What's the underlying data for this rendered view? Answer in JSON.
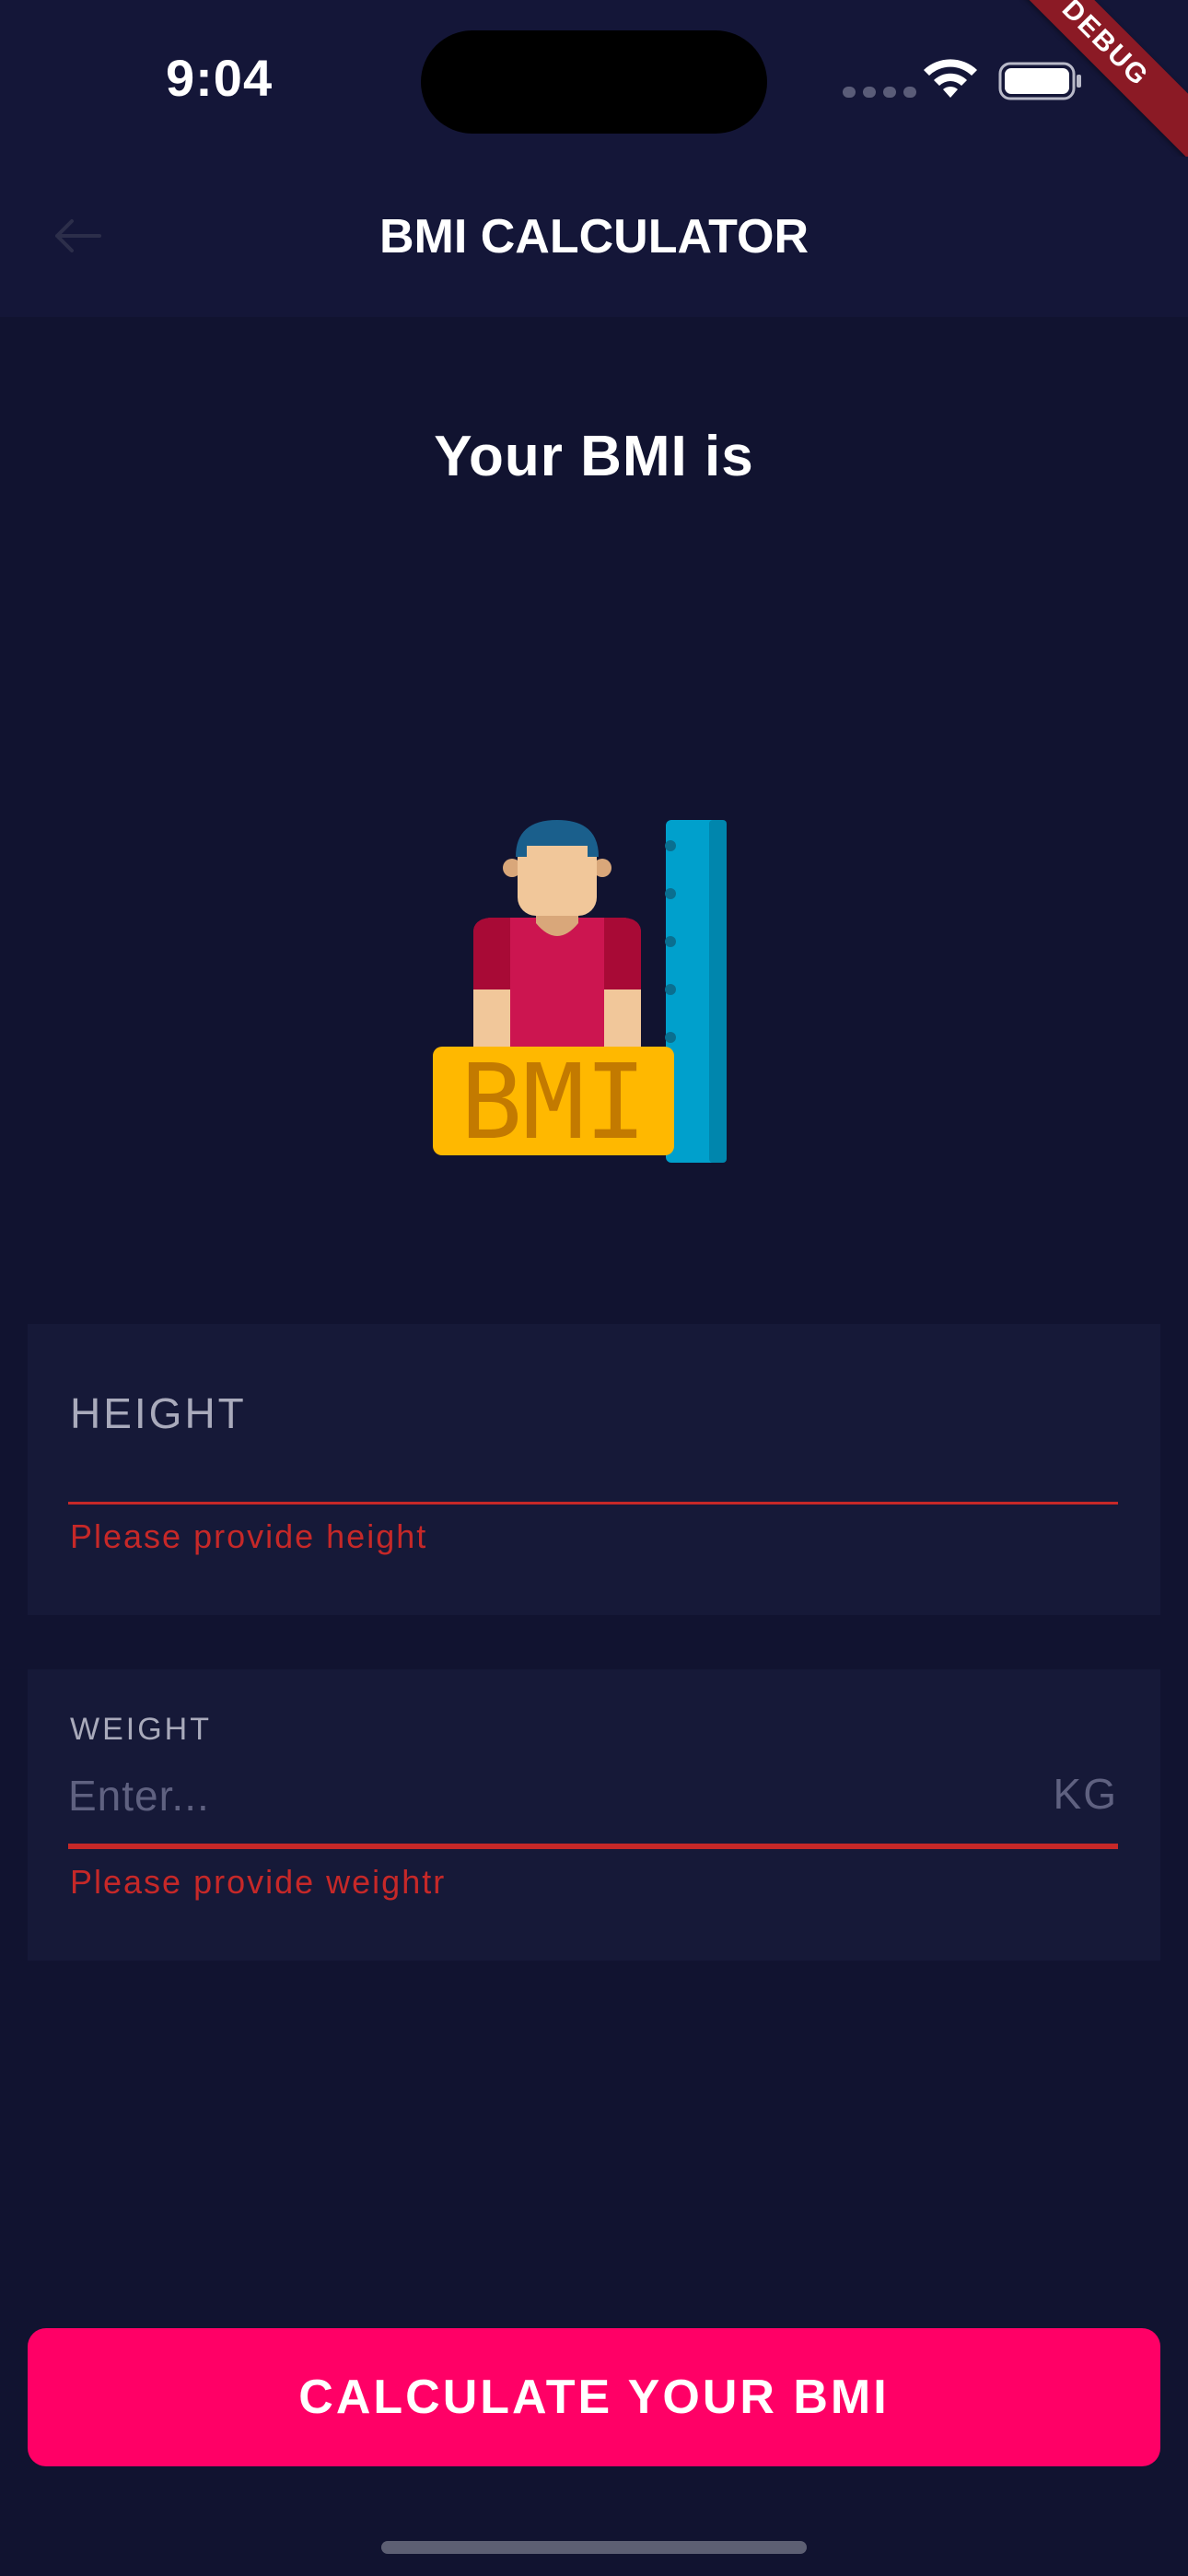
{
  "status_bar": {
    "time": "9:04",
    "debug_ribbon": "DEBUG"
  },
  "app_bar": {
    "title": "BMI CALCULATOR",
    "back_icon": "arrow-left-icon"
  },
  "result": {
    "heading": "Your BMI is",
    "illustration_text": "BMI"
  },
  "height_field": {
    "label": "HEIGHT",
    "error": "Please provide height"
  },
  "weight_field": {
    "label": "WEIGHT",
    "placeholder": "Enter...",
    "value": "",
    "suffix": "KG",
    "error": "Please provide weightr"
  },
  "calculate_button": {
    "label": "CALCULATE YOUR BMI"
  },
  "colors": {
    "background": "#111330",
    "card": "#161938",
    "accent": "#ff0066",
    "error": "#c62828",
    "debug": "#8b1a25"
  }
}
